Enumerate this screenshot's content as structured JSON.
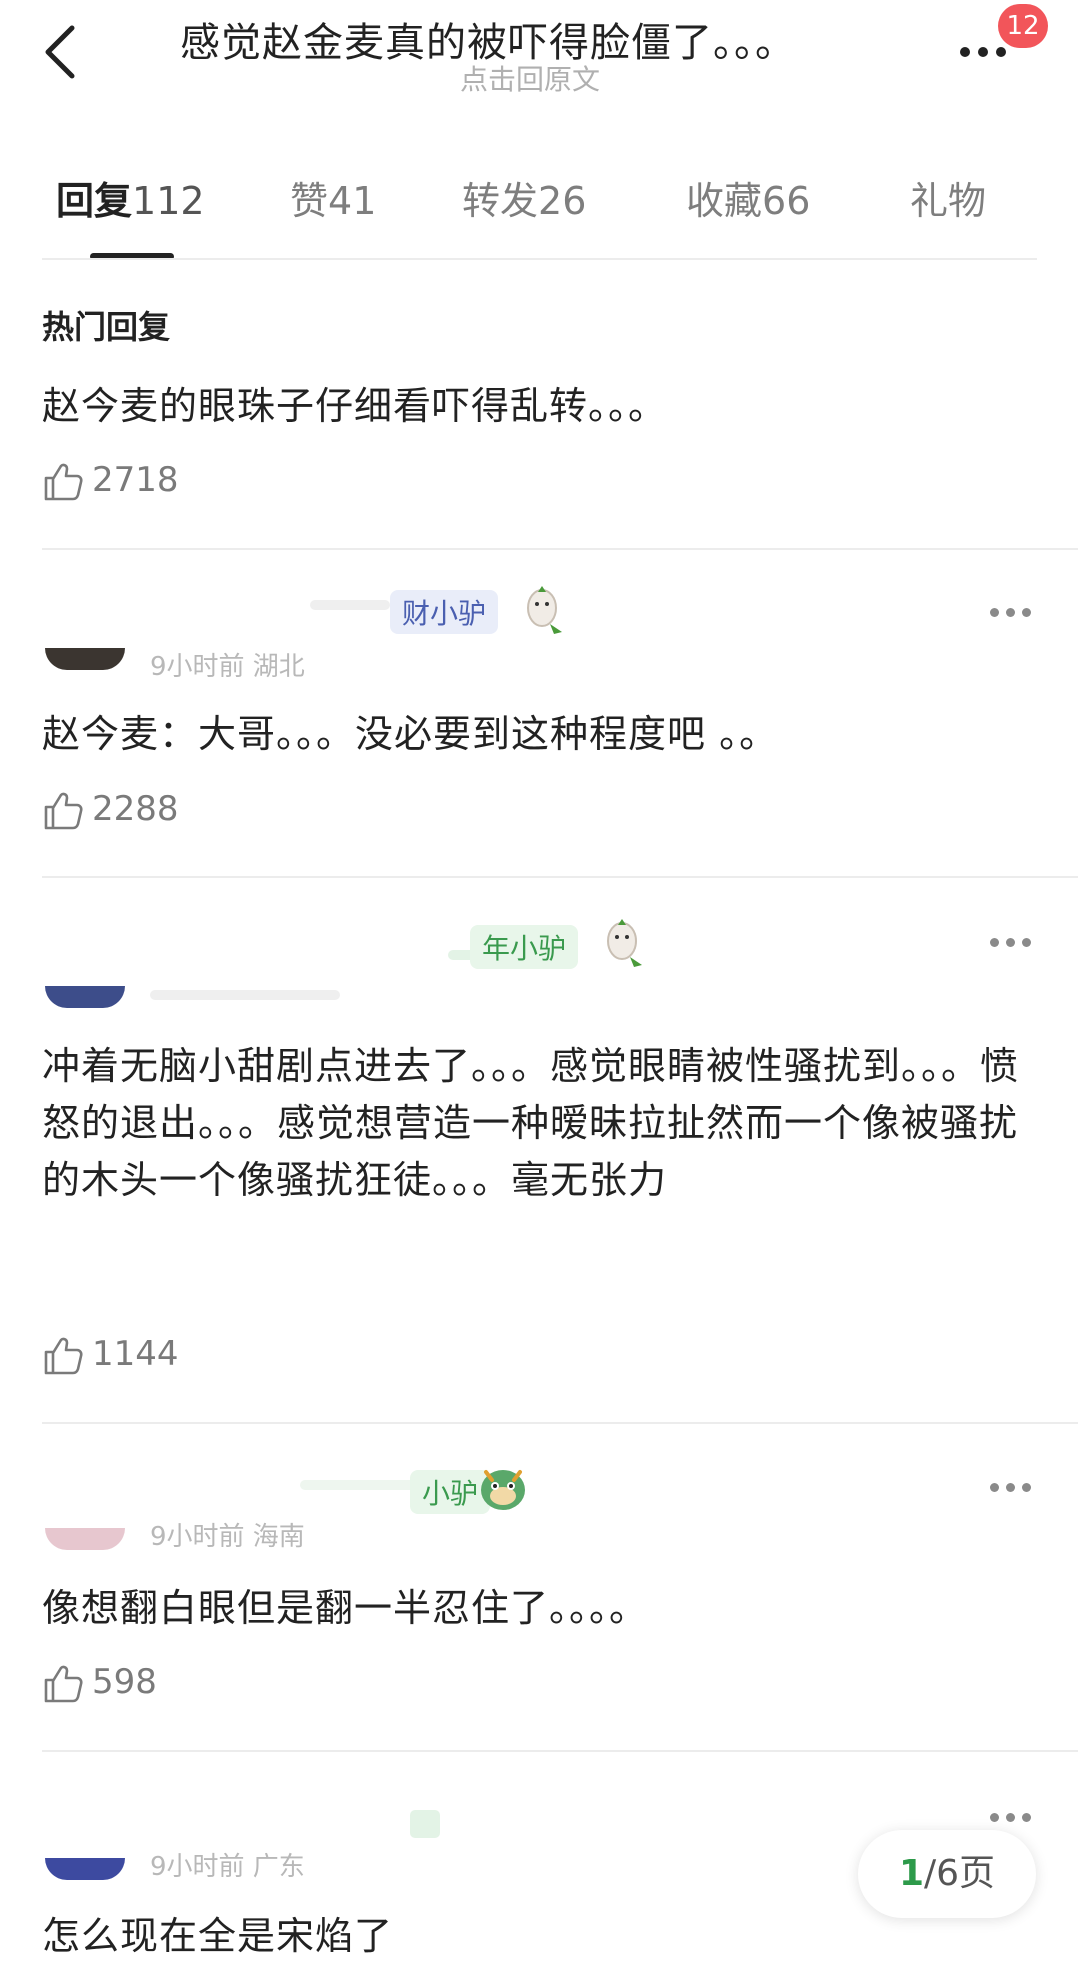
{
  "header": {
    "title": "感觉赵金麦真的被吓得脸僵了。。。",
    "subtitle": "点击回原文",
    "badge": "12"
  },
  "tabs": [
    {
      "label": "回复",
      "count": "112"
    },
    {
      "label": "赞",
      "count": "41"
    },
    {
      "label": "转发",
      "count": "26"
    },
    {
      "label": "收藏",
      "count": "66"
    },
    {
      "label": "礼物",
      "count": ""
    }
  ],
  "hot": {
    "section_label": "热门回复",
    "text": "赵今麦的眼珠子仔细看吓得乱转。。。",
    "likes": "2718"
  },
  "comments": [
    {
      "name_fragment": "财小驴",
      "meta": "9小时前 湖北",
      "text": "赵今麦：大哥。。。没必要到这种程度吧 。。",
      "likes": "2288"
    },
    {
      "name_fragment": "年小驴",
      "meta": "",
      "text": "冲着无脑小甜剧点进去了。。。感觉眼睛被性骚扰到。。。愤怒的退出。。。感觉想营造一种暧昧拉扯然而一个像被骚扰的木头一个像骚扰狂徒。。。毫无张力",
      "likes": "1144"
    },
    {
      "name_fragment": "小驴",
      "meta": "9小时前 海南",
      "text": "像想翻白眼但是翻一半忍住了。。。。",
      "likes": "598"
    },
    {
      "name_fragment": "",
      "meta": "9小时前 广东",
      "text": "怎么现在全是宋焰了",
      "likes": ""
    }
  ],
  "pager": {
    "current": "1",
    "rest": "/6页"
  },
  "colors": {
    "accent_green": "#2d9a4a",
    "badge_red": "#f2555a",
    "tag_blue_bg": "#e9edf9",
    "tag_green_bg": "#e8f6ea"
  }
}
